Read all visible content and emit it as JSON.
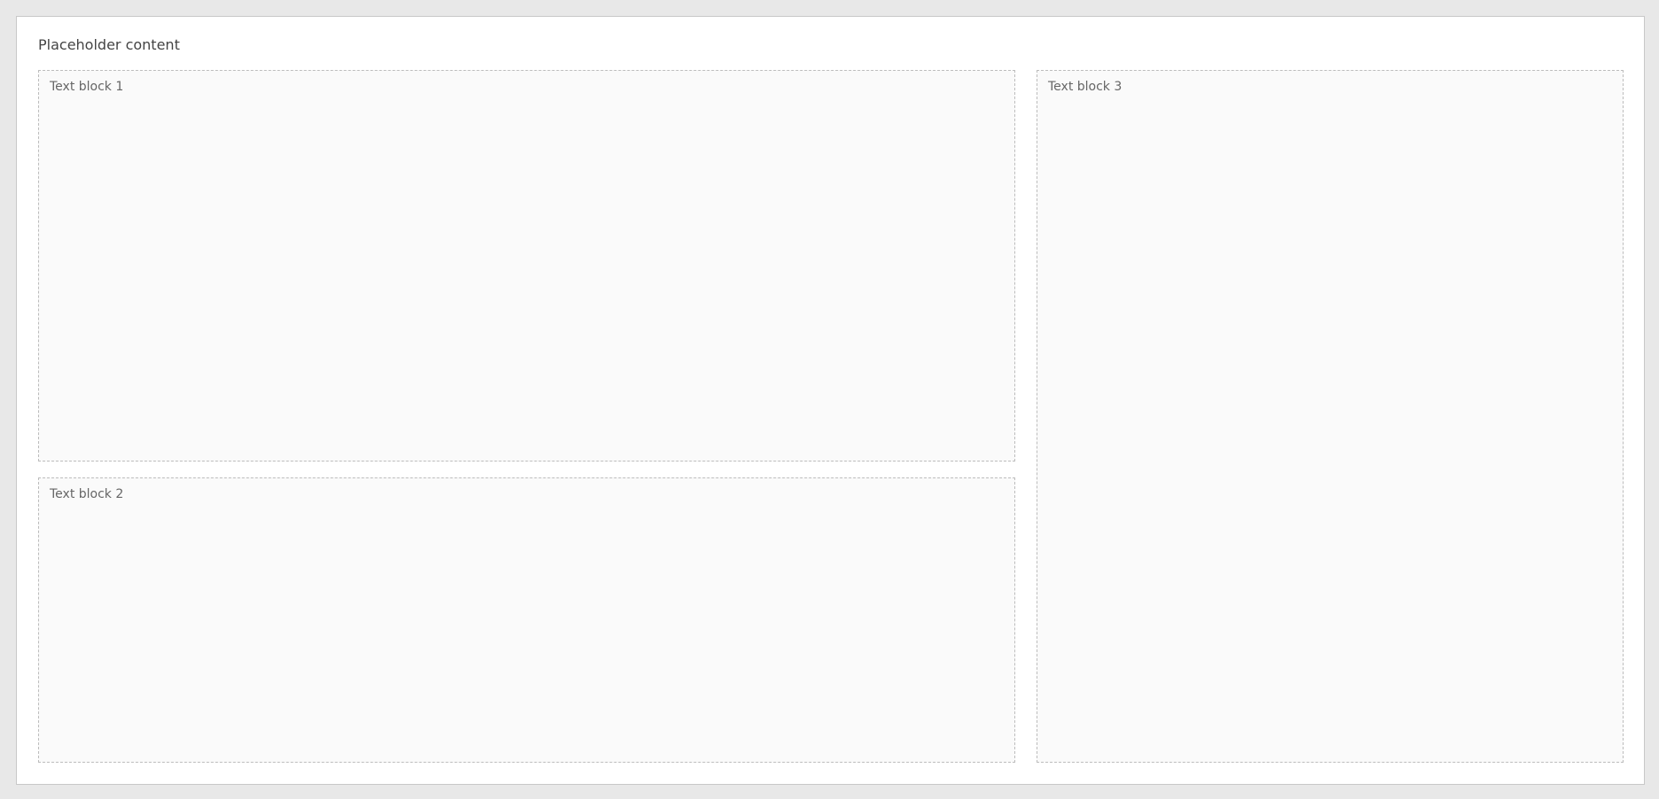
{
  "placeholder": {
    "headline": "Placeholder content",
    "panel_1": "Text block 1",
    "panel_2": "Text block 2",
    "panel_3": "Text block 3"
  }
}
